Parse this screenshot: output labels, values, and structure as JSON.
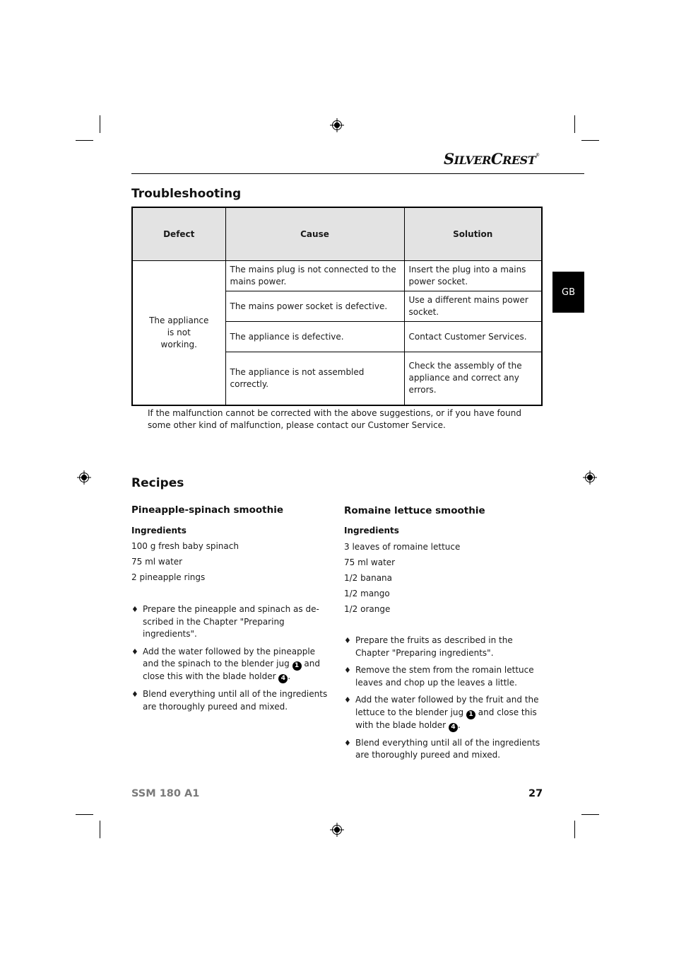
{
  "brand": {
    "logo_text_1": "S",
    "logo_text_2": "ILVER",
    "logo_text_3": "C",
    "logo_text_4": "REST",
    "logo_mark": "®"
  },
  "language_tab": "GB",
  "troubleshooting": {
    "title": "Troubleshooting",
    "headers": [
      "Defect",
      "Cause",
      "Solution"
    ],
    "defect": "The appliance is not working.",
    "rows": [
      {
        "cause": "The mains plug is not connected to the mains power.",
        "solution": "Insert the plug into a mains power socket."
      },
      {
        "cause": "The mains power socket is defective.",
        "solution": "Use a different mains power socket."
      },
      {
        "cause": "The appliance is defective.",
        "solution": "Contact Customer Services."
      },
      {
        "cause": "The appliance is not assembled correctly.",
        "solution": "Check the assembly of the appliance and correct any errors."
      }
    ],
    "note": "If the malfunction cannot be corrected with the above suggestions, or if you have found some other kind of malfunction, please contact our Customer Service."
  },
  "recipes": {
    "title": "Recipes",
    "items": [
      {
        "name": "Pineapple-spinach smoothie",
        "ingredients_label": "Ingredients",
        "ingredients": [
          "100 g fresh baby spinach",
          "75 ml water",
          "2 pineapple rings"
        ],
        "steps": [
          {
            "text": "Prepare the pineapple and spinach as de-scribed in the Chapter \"Preparing ingredients\"."
          },
          {
            "pre": "Add the water followed by the pineapple and the spinach to the blender jug",
            "ref1": "1",
            "mid": "and close this with the blade holder",
            "ref2": "4",
            "post": "."
          },
          {
            "text": "Blend everything until all of the ingredients are thoroughly pureed and mixed."
          }
        ]
      },
      {
        "name": "Romaine lettuce smoothie",
        "ingredients_label": "Ingredients",
        "ingredients": [
          "3 leaves of romaine lettuce",
          "75 ml water",
          "1/2 banana",
          "1/2 mango",
          "1/2 orange"
        ],
        "steps": [
          {
            "text": "Prepare the fruits as described in the Chapter \"Preparing ingredients\"."
          },
          {
            "text": "Remove the stem from the romain lettuce leaves and chop up the leaves a little."
          },
          {
            "pre": "Add the water followed by the fruit and the lettuce to the blender jug",
            "ref1": "1",
            "mid": "and close this with the blade holder",
            "ref2": "4",
            "post": "."
          },
          {
            "text": "Blend everything until all of the ingredients are thoroughly pureed and mixed."
          }
        ]
      }
    ]
  },
  "footer": {
    "model": "SSM 180 A1",
    "page_number": "27"
  },
  "bullet_glyph": "♦"
}
